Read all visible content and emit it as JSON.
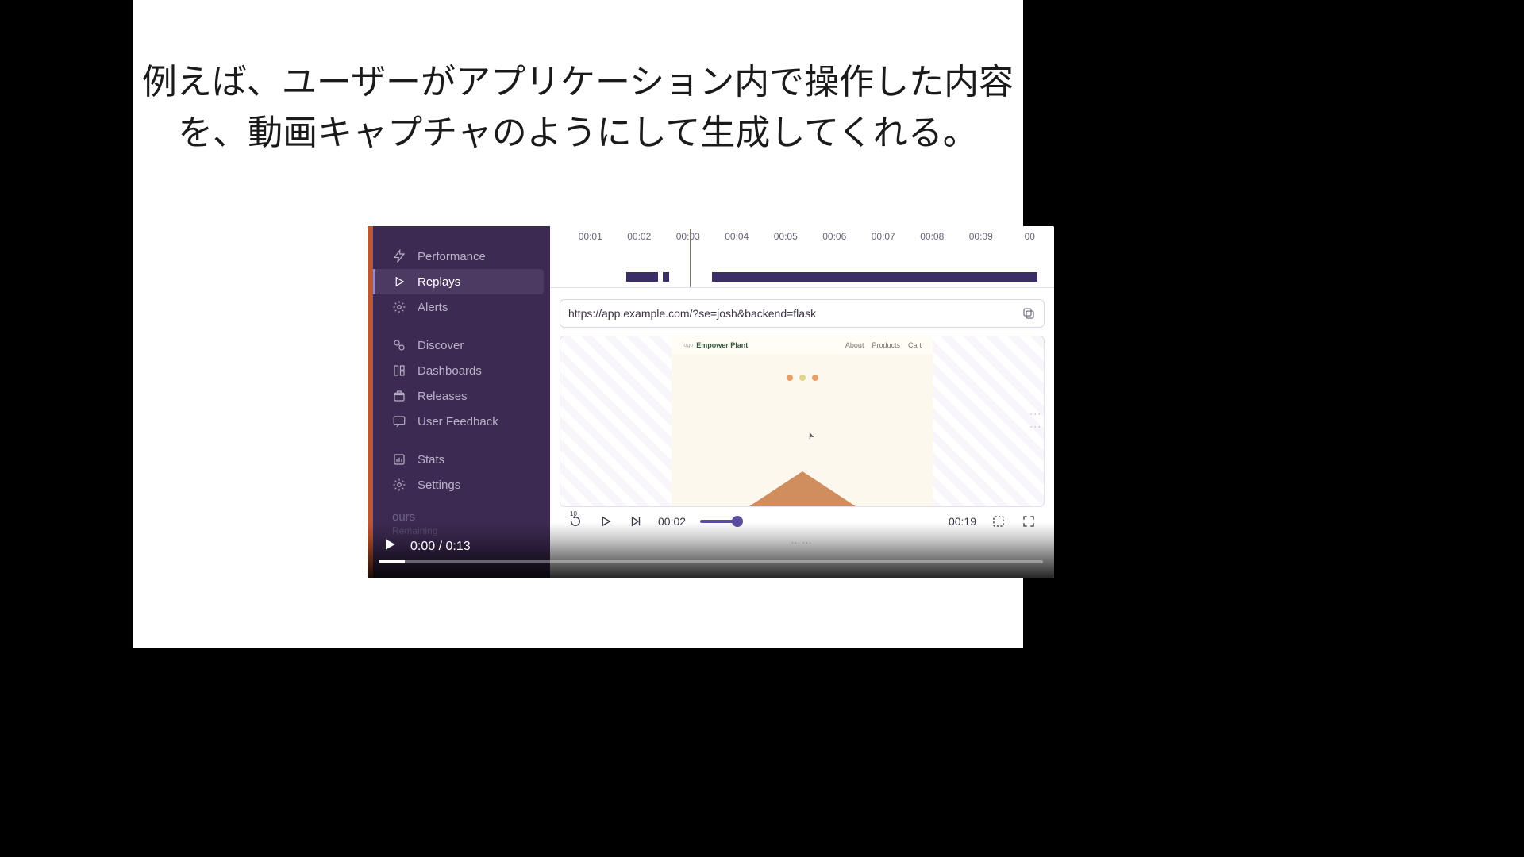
{
  "headline": "例えば、ユーザーがアプリケーション内で操作した内容を、動画キャプチャのようにして生成してくれる。",
  "sidebar": {
    "items": [
      {
        "label": "Performance",
        "icon": "bolt"
      },
      {
        "label": "Replays",
        "icon": "play",
        "active": true
      },
      {
        "label": "Alerts",
        "icon": "alert"
      }
    ],
    "items2": [
      {
        "label": "Discover",
        "icon": "link"
      },
      {
        "label": "Dashboards",
        "icon": "grid"
      },
      {
        "label": "Releases",
        "icon": "package"
      },
      {
        "label": "User Feedback",
        "icon": "feedback"
      }
    ],
    "items3": [
      {
        "label": "Stats",
        "icon": "stats"
      },
      {
        "label": "Settings",
        "icon": "gear"
      }
    ],
    "footer_label": "ours",
    "footer_sub": "Remaining"
  },
  "timeline": {
    "ticks": [
      "00:01",
      "00:02",
      "00:03",
      "00:04",
      "00:05",
      "00:06",
      "00:07",
      "00:08",
      "00:09",
      "00"
    ]
  },
  "url": "https://app.example.com/?se=josh&backend=flask",
  "site": {
    "logo_prefix": "logo",
    "brand": "Empower Plant",
    "links": [
      "About",
      "Products",
      "Cart"
    ]
  },
  "replay": {
    "back10": "10",
    "elapsed": "00:02",
    "total": "00:19"
  },
  "player": {
    "current": "0:00",
    "sep": " / ",
    "duration": "0:13"
  }
}
